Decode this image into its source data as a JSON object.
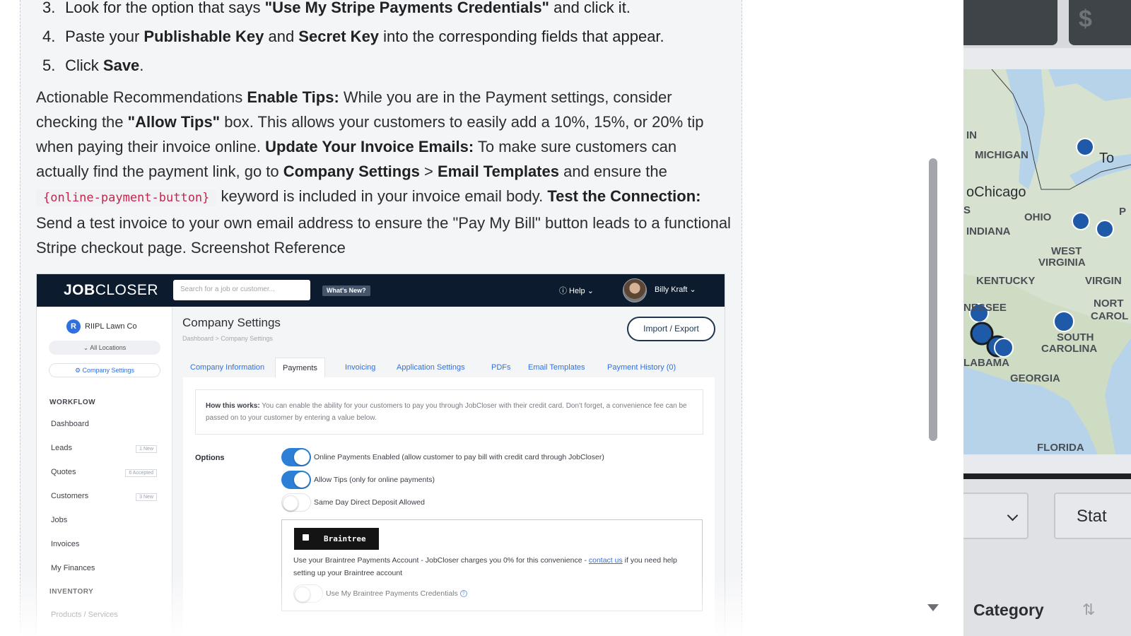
{
  "instructions": {
    "step3": {
      "num": "3.",
      "pre": "Look for the option that says ",
      "strong": "\"Use My Stripe Payments Credentials\"",
      "post": " and click it."
    },
    "step4": {
      "num": "4.",
      "pre": "Paste your ",
      "strong1": "Publishable Key",
      "mid": " and ",
      "strong2": "Secret Key",
      "post": " into the corresponding fields that appear."
    },
    "step5": {
      "num": "5.",
      "pre": "Click ",
      "strong": "Save",
      "post": "."
    }
  },
  "recommendations": {
    "intro": "Actionable Recommendations ",
    "tips_title": "Enable Tips:",
    "tips_text1": " While you are in the Payment settings, consider checking the ",
    "tips_box": "\"Allow Tips\"",
    "tips_text2": " box. This allows your customers to easily add a 10%, 15%, or 20% tip when paying their invoice online. ",
    "emails_title": "Update Your Invoice Emails:",
    "emails_text1": " To make sure customers can actually find the payment link, go to ",
    "company_settings": "Company Settings",
    "arrow": " > ",
    "email_templates": "Email Templates",
    "emails_text2": " and ensure the ",
    "keyword": "{online-payment-button}",
    "emails_text3": " keyword is included in your invoice email body. ",
    "test_title": "Test the Connection:",
    "test_text": " Send a test invoice to your own email address to ensure the \"Pay My Bill\" button leads to a functional Stripe checkout page. Screenshot Reference"
  },
  "screenshot": {
    "logo_bold": "JOB",
    "logo_rest": "CLOSER",
    "search_placeholder": "Search for a job or customer...",
    "whats_new": "What's New?",
    "help": "ⓘ Help  ⌄",
    "user": "Billy Kraft  ⌄",
    "company_badge": "R",
    "company": "RIIPL Lawn Co",
    "all_locations": "⌄  All Locations",
    "company_settings_pill": "⚙ Company Settings",
    "workflow": "WORKFLOW",
    "nav": {
      "dashboard": "Dashboard",
      "leads": "Leads",
      "leads_tag": "1 New",
      "quotes": "Quotes",
      "quotes_tag": "6 Accepted",
      "customers": "Customers",
      "customers_tag": "3 New",
      "jobs": "Jobs",
      "invoices": "Invoices",
      "my_finances": "My Finances"
    },
    "inventory": "INVENTORY",
    "products": "Products / Services",
    "title": "Company Settings",
    "breadcrumb": "Dashboard  >  Company Settings",
    "import_export": "Import / Export",
    "tabs": {
      "company_info": "Company Information",
      "payments": "Payments",
      "invoicing": "Invoicing",
      "app_settings": "Application Settings",
      "pdfs": "PDFs",
      "email_templates": "Email Templates",
      "payment_history": "Payment History (0)"
    },
    "how_label": "How this works:",
    "how_text": " You can enable the ability for your customers to pay you through JobCloser with their credit card. Don't forget, a convenience fee can be passed on to your customer by entering a value below.",
    "options": "Options",
    "opt_online": "Online Payments Enabled (allow customer to pay bill with credit card through JobCloser)",
    "opt_tips": "Allow Tips (only for online payments)",
    "opt_same_day": "Same Day Direct Deposit Allowed",
    "braintree": "Braintree",
    "bt_text1": "Use your Braintree Payments Account - JobCloser charges you 0% for this convenience - ",
    "bt_link": "contact us",
    "bt_text2": " if you need help setting up your Braintree account",
    "bt_credentials": "Use My Braintree Payments Credentials"
  },
  "map_panel": {
    "btn2_text": "$",
    "labels": {
      "michigan": "MICHIGAN",
      "chicago": "oChicago",
      "ohio": "OHIO",
      "indiana": "INDIANA",
      "west_virginia_1": "WEST",
      "west_virginia_2": "VIRGINIA",
      "kentucky": "KENTUCKY",
      "virgin": "VIRGIN",
      "nort": "NORT",
      "carol": "CAROL",
      "tennessee": "NESSEE",
      "south_carolina_1": "SOUTH",
      "south_carolina_2": "CAROLINA",
      "alabama": "LABAMA",
      "georgia": "GEORGIA",
      "florida": "FLORIDA",
      "in": "IN",
      "s": "S",
      "to": "To",
      "p": "P"
    },
    "stat": "Stat",
    "category": "Category",
    "sort_icon": "⇅"
  },
  "colors": {
    "code_text": "#c7254e",
    "jc_navy": "#0c1b2e",
    "jc_blue": "#2f6fe0",
    "toggle_on": "#2b7fd6",
    "map_water": "#b7d3e9",
    "map_marker": "#1f5aa8"
  }
}
